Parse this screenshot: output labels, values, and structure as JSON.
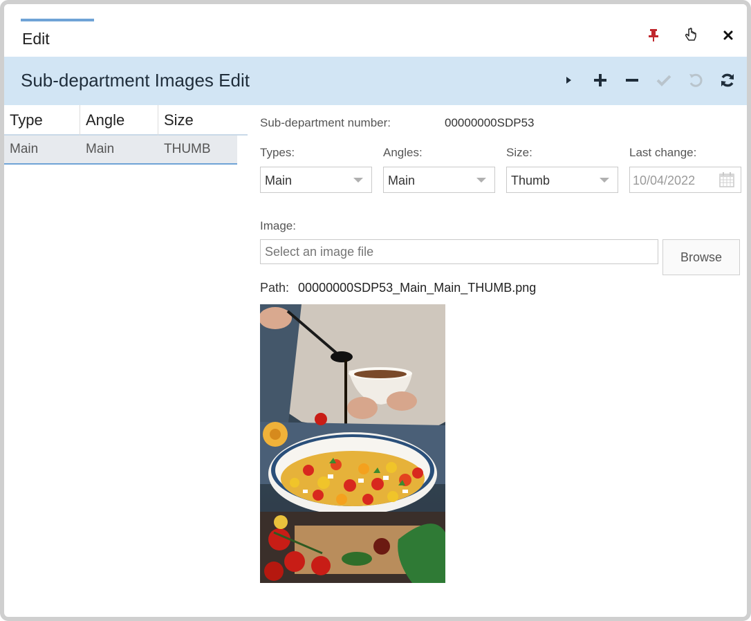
{
  "window": {
    "tab_label": "Edit",
    "icons": [
      "pin-icon",
      "pointer-icon",
      "close-icon"
    ]
  },
  "header": {
    "title": "Sub-department Images Edit",
    "toolbar_icons": [
      "play-icon",
      "add-icon",
      "remove-icon",
      "confirm-icon",
      "undo-icon",
      "refresh-icon"
    ]
  },
  "grid": {
    "columns": [
      "Type",
      "Angle",
      "Size"
    ],
    "rows": [
      {
        "type": "Main",
        "angle": "Main",
        "size": "THUMB"
      }
    ]
  },
  "form": {
    "subdept_label": "Sub-department number:",
    "subdept_value": "00000000SDP53",
    "types_label": "Types:",
    "types_value": "Main",
    "angles_label": "Angles:",
    "angles_value": "Main",
    "size_label": "Size:",
    "size_value": "Thumb",
    "last_change_label": "Last change:",
    "last_change_value": "10/04/2022",
    "image_label": "Image:",
    "image_placeholder": "Select an image file",
    "browse_label": "Browse",
    "path_label": "Path:",
    "path_value": "00000000SDP53_Main_Main_THUMB.png"
  },
  "colors": {
    "title_bar": "#d2e5f4",
    "accent": "#6fa3d6",
    "pin": "#c0272d"
  }
}
